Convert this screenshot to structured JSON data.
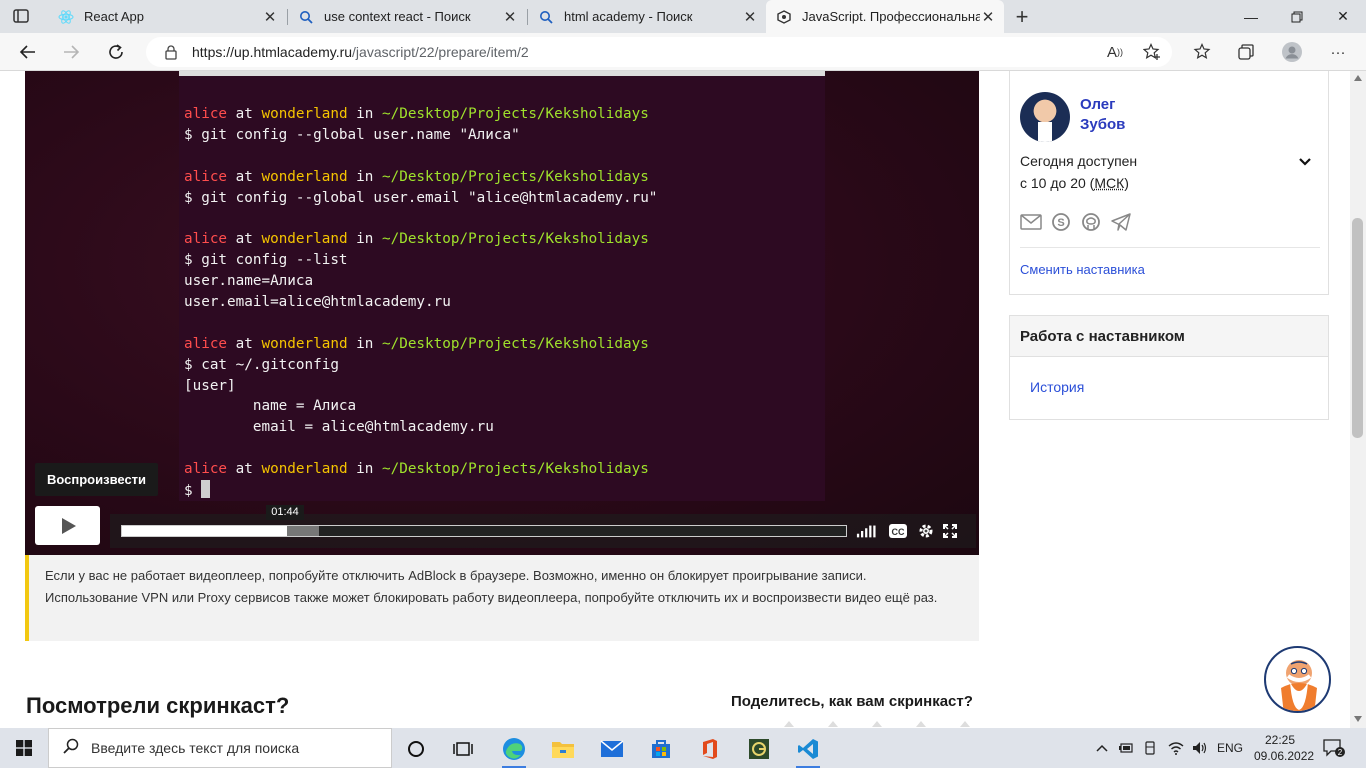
{
  "browser": {
    "tabs": [
      {
        "title": "React App",
        "icon": "react-icon"
      },
      {
        "title": "use context react - Поиск",
        "icon": "search-icon"
      },
      {
        "title": "html academy - Поиск",
        "icon": "search-icon"
      },
      {
        "title": "JavaScript. Профессиональная р",
        "icon": "htmlacademy-icon",
        "active": true
      }
    ],
    "url_base": "https://up.htmlacademy.ru",
    "url_path": "/javascript/22/prepare/item/2"
  },
  "video": {
    "terminal_lines": [
      {
        "type": "prompt",
        "user": "alice",
        "at": " at ",
        "host": "wonderland",
        "in": " in ",
        "path": "~/Desktop/Projects/Keksholidays"
      },
      {
        "type": "text",
        "text": "$ git config --global user.name \"Алиса\""
      },
      {
        "type": "blank",
        "text": ""
      },
      {
        "type": "prompt",
        "user": "alice",
        "at": " at ",
        "host": "wonderland",
        "in": " in ",
        "path": "~/Desktop/Projects/Keksholidays"
      },
      {
        "type": "text",
        "text": "$ git config --global user.email \"alice@htmlacademy.ru\""
      },
      {
        "type": "blank",
        "text": ""
      },
      {
        "type": "prompt",
        "user": "alice",
        "at": " at ",
        "host": "wonderland",
        "in": " in ",
        "path": "~/Desktop/Projects/Keksholidays"
      },
      {
        "type": "text",
        "text": "$ git config --list"
      },
      {
        "type": "text",
        "text": "user.name=Алиса"
      },
      {
        "type": "text",
        "text": "user.email=alice@htmlacademy.ru"
      },
      {
        "type": "blank",
        "text": ""
      },
      {
        "type": "prompt",
        "user": "alice",
        "at": " at ",
        "host": "wonderland",
        "in": " in ",
        "path": "~/Desktop/Projects/Keksholidays"
      },
      {
        "type": "text",
        "text": "$ cat ~/.gitconfig"
      },
      {
        "type": "text",
        "text": "[user]"
      },
      {
        "type": "text",
        "text": "        name = Алиса"
      },
      {
        "type": "text",
        "text": "        email = alice@htmlacademy.ru"
      },
      {
        "type": "blank",
        "text": ""
      },
      {
        "type": "prompt",
        "user": "alice",
        "at": " at ",
        "host": "wonderland",
        "in": " in ",
        "path": "~/Desktop/Projects/Keksholidays"
      },
      {
        "type": "cursor",
        "text": "$ "
      }
    ],
    "play_tooltip": "Воспроизвести",
    "time_label": "01:44",
    "played_fraction": 0.228,
    "loaded_fraction": 0.272
  },
  "notice": "Если у вас не работает видеоплеер, попробуйте отключить AdBlock в браузере. Возможно, именно он блокирует проигрывание записи. Использование VPN или Proxy сервисов также может блокировать работу видеоплеера, попробуйте отключить их и воспроизвести видео ещё раз.",
  "feedback": {
    "title": "Посмотрели скринкаст?",
    "share": "Поделитесь, как вам скринкаст?"
  },
  "mentor": {
    "first_name": "Олег",
    "last_name": "Зубов",
    "availability": "Сегодня доступен",
    "hours_prefix": "с 10 до 20 (",
    "timezone": "МСК",
    "hours_suffix": ")",
    "contacts": [
      "mail-icon",
      "skype-icon",
      "github-icon",
      "telegram-icon"
    ],
    "change_link": "Сменить наставника"
  },
  "work": {
    "title": "Работа с наставником",
    "history_link": "История"
  },
  "taskbar": {
    "search_placeholder": "Введите здесь текст для поиска",
    "language": "ENG",
    "time": "22:25",
    "date": "09.06.2022",
    "notifications": "2"
  }
}
